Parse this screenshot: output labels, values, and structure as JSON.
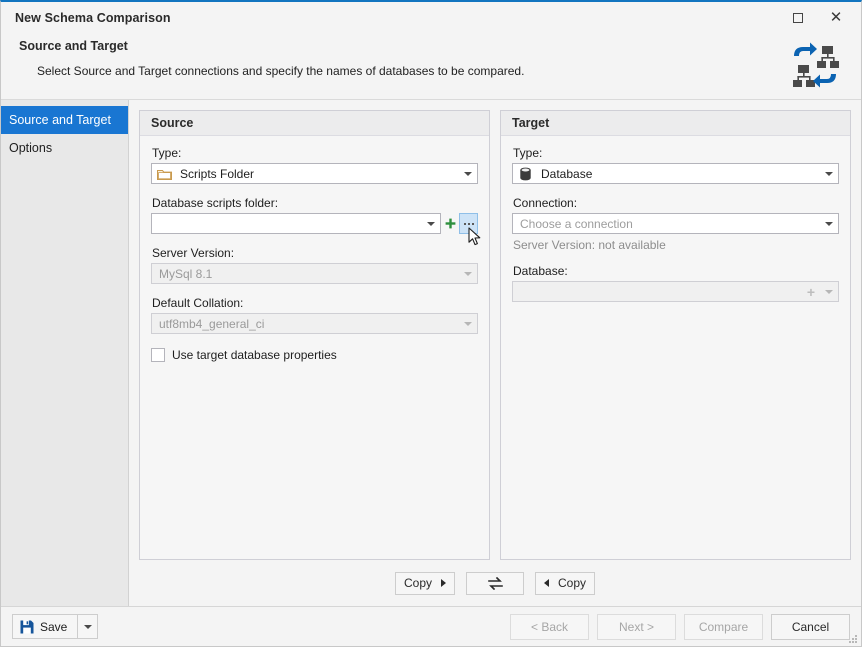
{
  "window": {
    "title": "New Schema Comparison",
    "maximize_icon": "maximize-square-icon",
    "close_icon": "close-x-icon",
    "close_glyph": "✕"
  },
  "header": {
    "title": "Source and Target",
    "subtitle": "Select Source and Target connections and specify the names of databases to be compared.",
    "logo_icon": "schema-comparison-logo-icon",
    "accent_color": "#1275c0"
  },
  "sidebar": {
    "items": [
      {
        "label": "Source and Target",
        "selected": true
      },
      {
        "label": "Options",
        "selected": false
      }
    ],
    "selected_color": "#1976d2"
  },
  "source": {
    "panel_title": "Source",
    "type_label": "Type:",
    "type_value": "Scripts Folder",
    "type_icon": "folder-icon",
    "scripts_folder_label": "Database scripts folder:",
    "scripts_folder_value": "",
    "scripts_folder_placeholder": "",
    "add_icon": "plus-icon",
    "browse_icon": "ellipsis-icon",
    "server_version_label": "Server Version:",
    "server_version_value": "MySql 8.1",
    "default_collation_label": "Default Collation:",
    "default_collation_value": "utf8mb4_general_ci",
    "use_target_props_label": "Use target database properties",
    "use_target_props_checked": false
  },
  "target": {
    "panel_title": "Target",
    "type_label": "Type:",
    "type_value": "Database",
    "type_icon": "database-icon",
    "connection_label": "Connection:",
    "connection_placeholder": "Choose a connection",
    "connection_value": "",
    "server_version_text": "Server Version: not available",
    "database_label": "Database:",
    "database_value": "",
    "database_add_icon": "plus-icon"
  },
  "copybar": {
    "copy_to_target_label": "Copy",
    "copy_to_target_icon": "arrow-right-icon",
    "swap_label": "",
    "swap_icon": "swap-arrows-icon",
    "copy_to_source_label": "Copy",
    "copy_to_source_icon": "arrow-left-icon"
  },
  "footer": {
    "save_label": "Save",
    "save_icon": "floppy-disk-icon",
    "save_dropdown_icon": "chevron-down-icon",
    "back_label": "< Back",
    "back_disabled": true,
    "next_label": "Next >",
    "next_disabled": true,
    "compare_label": "Compare",
    "compare_disabled": true,
    "cancel_label": "Cancel",
    "cancel_disabled": false
  }
}
